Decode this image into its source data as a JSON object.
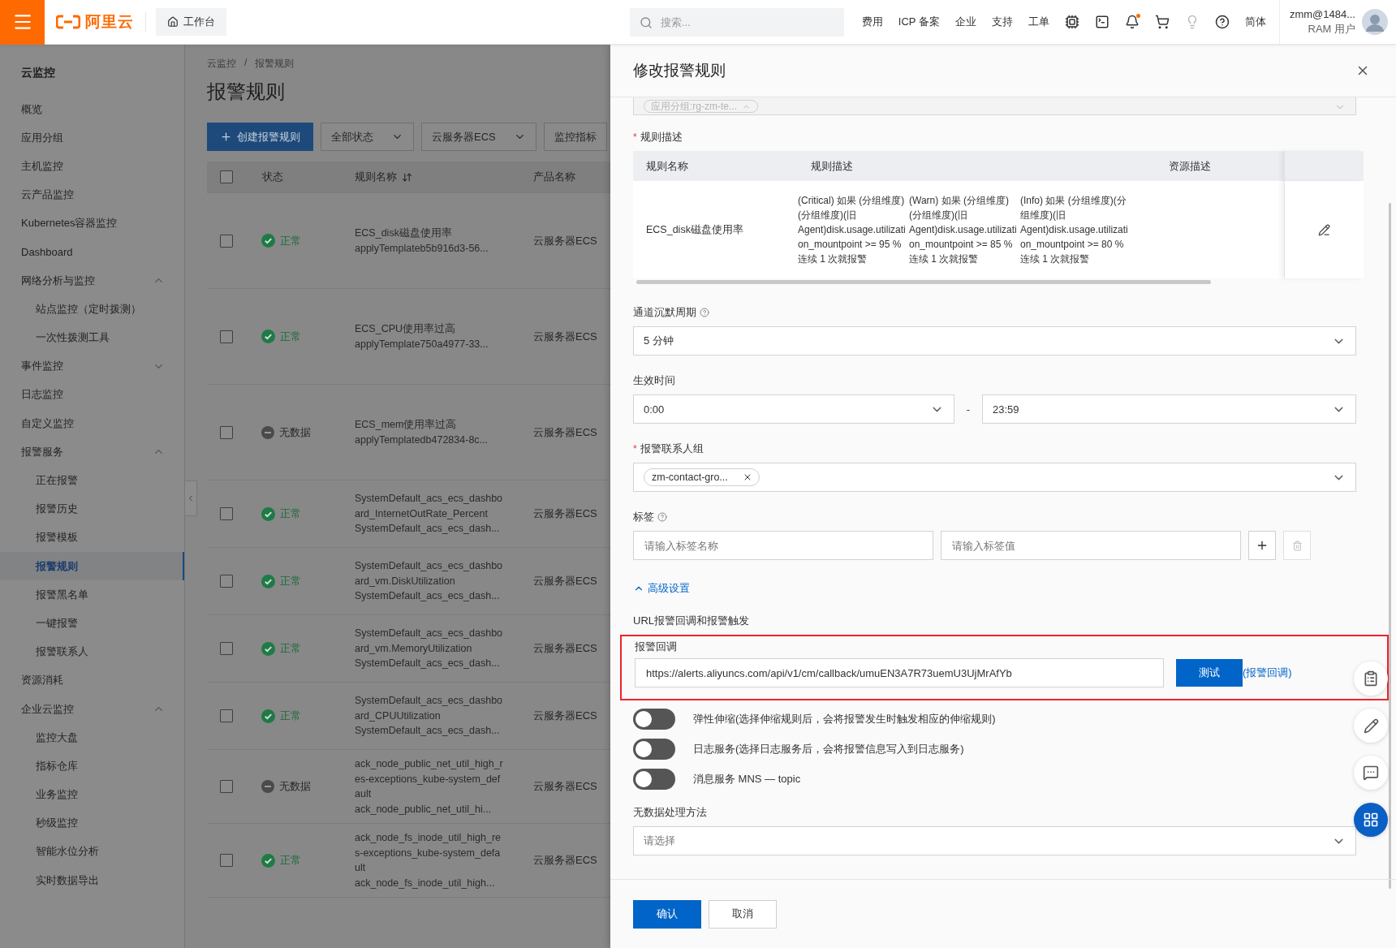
{
  "topbar": {
    "logo_text": "阿里云",
    "workbench": "工作台",
    "search": {
      "placeholder": "搜索..."
    },
    "nav_links": [
      "费用",
      "ICP 备案",
      "企业",
      "支持",
      "工单"
    ],
    "has_unread": true,
    "language": "简体",
    "user": {
      "name": "zmm@1484...",
      "role": "RAM 用户"
    }
  },
  "sidebar": {
    "title": "云监控",
    "items": [
      {
        "kind": "link",
        "label": "概览",
        "selected": false
      },
      {
        "kind": "link",
        "label": "应用分组",
        "selected": false
      },
      {
        "kind": "link",
        "label": "主机监控",
        "selected": false
      },
      {
        "kind": "link",
        "label": "云产品监控",
        "selected": false
      },
      {
        "kind": "link",
        "label": "Kubernetes容器监控",
        "selected": false
      },
      {
        "kind": "link",
        "label": "Dashboard",
        "selected": false
      },
      {
        "kind": "group",
        "label": "网络分析与监控",
        "expanded": true,
        "children": [
          {
            "label": "站点监控（定时拨测）",
            "selected": false
          },
          {
            "label": "一次性拨测工具",
            "selected": false
          }
        ]
      },
      {
        "kind": "group",
        "label": "事件监控",
        "expanded": false
      },
      {
        "kind": "link",
        "label": "日志监控",
        "selected": false
      },
      {
        "kind": "link",
        "label": "自定义监控",
        "selected": false
      },
      {
        "kind": "group",
        "label": "报警服务",
        "expanded": true,
        "children": [
          {
            "label": "正在报警",
            "selected": false
          },
          {
            "label": "报警历史",
            "selected": false
          },
          {
            "label": "报警模板",
            "selected": false
          },
          {
            "label": "报警规则",
            "selected": true
          },
          {
            "label": "报警黑名单",
            "selected": false
          },
          {
            "label": "一键报警",
            "selected": false
          },
          {
            "label": "报警联系人",
            "selected": false
          }
        ]
      },
      {
        "kind": "link",
        "label": "资源消耗",
        "selected": false
      },
      {
        "kind": "group",
        "label": "企业云监控",
        "expanded": true,
        "children": [
          {
            "label": "监控大盘",
            "selected": false
          },
          {
            "label": "指标仓库",
            "selected": false
          },
          {
            "label": "业务监控",
            "selected": false
          },
          {
            "label": "秒级监控",
            "selected": false
          },
          {
            "label": "智能水位分析",
            "selected": false
          },
          {
            "label": "实时数据导出",
            "selected": false
          }
        ]
      }
    ]
  },
  "page": {
    "breadcrumb": [
      "云监控",
      "报警规则"
    ],
    "breadcrumb_separator": "/",
    "title": "报警规则",
    "create_button": "创建报警规则",
    "filters": [
      {
        "label": "全部状态",
        "caret": true
      },
      {
        "label": "云服务器ECS",
        "caret": true
      },
      {
        "label": "监控指标",
        "caret": false
      }
    ],
    "table": {
      "all_checked": false,
      "columns": [
        {
          "label": "状态",
          "sortable": false
        },
        {
          "label": "规则名称",
          "sortable": true
        },
        {
          "label": "产品名称",
          "sortable": false
        }
      ],
      "rows": [
        {
          "checked": false,
          "kind": "ok",
          "status_label": "正常",
          "name": "ECS_disk磁盘使用率",
          "sub": "applyTemplateb5b916d3-56...",
          "product": "云服务器ECS"
        },
        {
          "checked": false,
          "kind": "ok",
          "status_label": "正常",
          "name": "ECS_CPU使用率过高",
          "sub": "applyTemplate750a4977-33...",
          "product": "云服务器ECS"
        },
        {
          "checked": false,
          "kind": "nodata",
          "status_label": "无数据",
          "name": "ECS_mem使用率过高",
          "sub": "applyTemplatedb472834-8c...",
          "product": "云服务器ECS"
        },
        {
          "checked": false,
          "kind": "ok",
          "status_label": "正常",
          "name": "SystemDefault_acs_ecs_dashboard_InternetOutRate_Percent",
          "sub": "SystemDefault_acs_ecs_dash...",
          "product": "云服务器ECS"
        },
        {
          "checked": false,
          "kind": "ok",
          "status_label": "正常",
          "name": "SystemDefault_acs_ecs_dashboard_vm.DiskUtilization",
          "sub": "SystemDefault_acs_ecs_dash...",
          "product": "云服务器ECS"
        },
        {
          "checked": false,
          "kind": "ok",
          "status_label": "正常",
          "name": "SystemDefault_acs_ecs_dashboard_vm.MemoryUtilization",
          "sub": "SystemDefault_acs_ecs_dash...",
          "product": "云服务器ECS"
        },
        {
          "checked": false,
          "kind": "ok",
          "status_label": "正常",
          "name": "SystemDefault_acs_ecs_dashboard_CPUUtilization",
          "sub": "SystemDefault_acs_ecs_dash...",
          "product": "云服务器ECS"
        },
        {
          "checked": false,
          "kind": "nodata",
          "status_label": "无数据",
          "name": "ack_node_public_net_util_high_res-exceptions_kube-system_default",
          "sub": "ack_node_public_net_util_hi...",
          "product": "云服务器ECS"
        },
        {
          "checked": false,
          "kind": "ok",
          "status_label": "正常",
          "name": "ack_node_fs_inode_util_high_res-exceptions_kube-system_default",
          "sub": "ack_node_fs_inode_util_high...",
          "product": "云服务器ECS"
        }
      ]
    }
  },
  "drawer": {
    "title": "修改报警规则",
    "top_field": {
      "tag": "应用分组:rg-zm-te..."
    },
    "rule_section": {
      "label": "规则描述",
      "required_mark": "*",
      "columns": [
        "规则名称",
        "规则描述",
        "资源描述"
      ],
      "rows": [
        {
          "name": "ECS_disk磁盘使用率",
          "descriptions": [
            "(Critical) 如果 (分组维度)(分组维度)(旧Agent)disk.usage.utilization_mountpoint >= 95 % 连续 1 次就报警",
            "(Warn) 如果 (分组维度)(分组维度)(旧Agent)disk.usage.utilization_mountpoint >= 85 % 连续 1 次就报警",
            "(Info) 如果 (分组维度)(分组维度)(旧Agent)disk.usage.utilization_mountpoint >= 80 % 连续 1 次就报警"
          ]
        }
      ]
    },
    "silence": {
      "label": "通道沉默周期",
      "help": true,
      "value": "5 分钟"
    },
    "effective_time": {
      "label": "生效时间",
      "start": "0:00",
      "separator": "-",
      "end": "23:59"
    },
    "contact_group": {
      "label": "报警联系人组",
      "required_mark": "*",
      "tags": [
        "zm-contact-gro..."
      ]
    },
    "tags_field": {
      "label": "标签",
      "help": true,
      "name_placeholder": "请输入标签名称",
      "value_placeholder": "请输入标签值"
    },
    "advanced_link": {
      "label": "高级设置",
      "expanded": true
    },
    "url_section": {
      "label": "URL报警回调和报警触发",
      "callback": {
        "label": "报警回调",
        "highlighted": true,
        "value": "https://alerts.aliyuncs.com/api/v1/cm/callback/umuEN3A7R73uemU3UjMrAfYb",
        "test_button": "测试",
        "link": "(报警回调)"
      }
    },
    "integrations": [
      {
        "label": "弹性伸缩(选择伸缩规则后，会将报警发生时触发相应的伸缩规则)",
        "on": false
      },
      {
        "label": "日志服务(选择日志服务后，会将报警信息写入到日志服务)",
        "on": false
      },
      {
        "label": "消息服务 MNS — topic",
        "on": false
      }
    ],
    "no_data": {
      "label": "无数据处理方法",
      "placeholder": "请选择"
    },
    "buttons": [
      {
        "label": "确认",
        "kind": "primary"
      },
      {
        "label": "取消",
        "kind": "default"
      }
    ]
  }
}
